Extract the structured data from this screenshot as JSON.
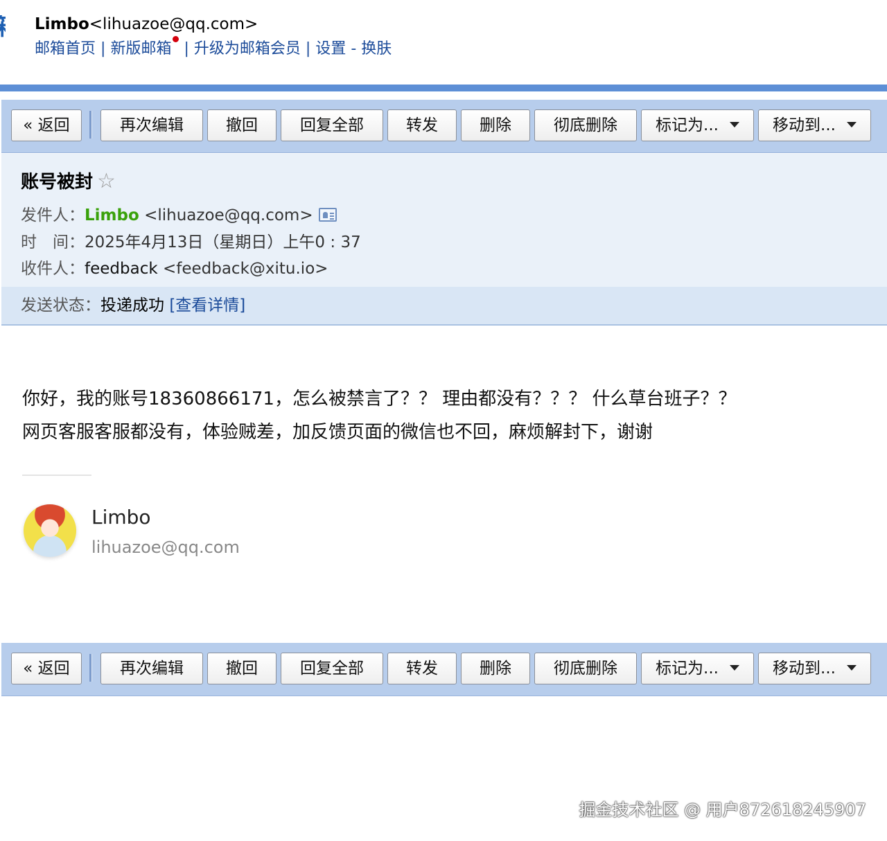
{
  "header": {
    "user_name": "Limbo",
    "user_email": "<lihuazoe@qq.com>",
    "nav": [
      "邮箱首页",
      "新版邮箱",
      "升级为邮箱会员",
      "设置",
      "换肤"
    ],
    "nav_sep": "|",
    "nav_dash": "-"
  },
  "toolbar": {
    "back": "« 返回",
    "reedit": "再次编辑",
    "recall": "撤回",
    "reply_all": "回复全部",
    "forward": "转发",
    "delete": "删除",
    "perm_delete": "彻底删除",
    "mark_as": "标记为...",
    "move_to": "移动到..."
  },
  "mail": {
    "subject": "账号被封",
    "star": "☆",
    "from_label": "发件人：",
    "from_name": "Limbo",
    "from_email": "<lihuazoe@qq.com>",
    "time_label": "时　间：",
    "time_value": "2025年4月13日（星期日）上午0 : 37",
    "to_label": "收件人：",
    "to_name": "feedback",
    "to_email": "<feedback@xitu.io>",
    "status_label": "发送状态：",
    "status_value": "投递成功",
    "status_detail": "[查看详情]",
    "body_lines": [
      "你好，我的账号18360866171，怎么被禁言了？？ 理由都没有？？？ 什么草台班子？？",
      "网页客服客服都没有，体验贼差，加反馈页面的微信也不回，麻烦解封下，谢谢"
    ]
  },
  "signature": {
    "name": "Limbo",
    "email": "lihuazoe@qq.com"
  },
  "watermark": "掘金技术社区 @ 用户872618245907",
  "colors": {
    "accent": "#1a4a99",
    "toolbar_bg": "#b7cdec",
    "header_bg": "#eaf1f9",
    "sender_green": "#39a10a"
  }
}
